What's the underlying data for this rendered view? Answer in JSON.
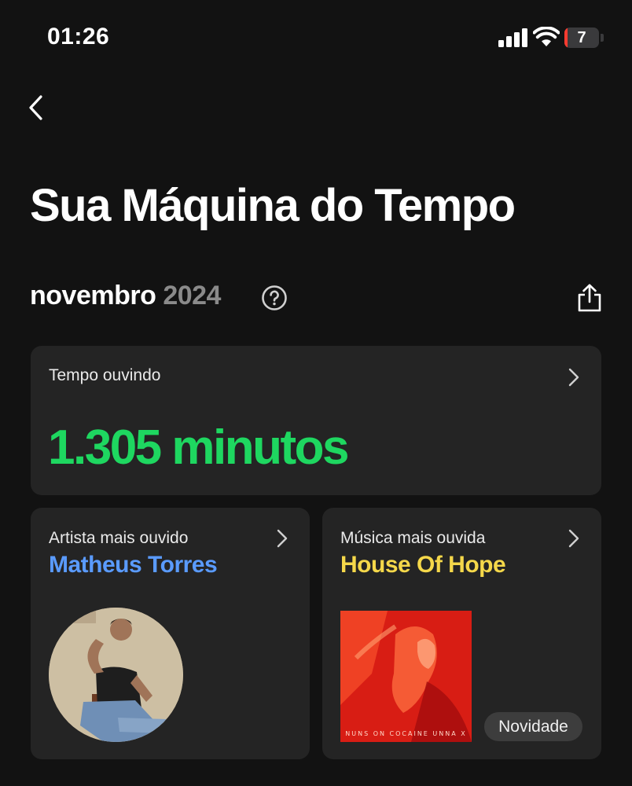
{
  "status_bar": {
    "time": "01:26",
    "battery_level": "7",
    "battery_color": "#ff3b30"
  },
  "header": {
    "back_icon": "chevron-left-icon",
    "title": "Sua Máquina do Tempo"
  },
  "period": {
    "month": "novembro",
    "year": "2024",
    "help_icon": "question-circle-icon",
    "share_icon": "share-icon"
  },
  "listening_time": {
    "label": "Tempo ouvindo",
    "value": "1.305 minutos",
    "value_color": "#1ed760"
  },
  "top_artist": {
    "label": "Artista mais ouvido",
    "name": "Matheus Torres",
    "name_color": "#5a9bff"
  },
  "top_song": {
    "label": "Música mais ouvida",
    "title": "House Of Hope",
    "title_color": "#f5d84a",
    "cover_caption": "NUNS ON COCAINE   UNNA X",
    "badge": "Novidade"
  }
}
